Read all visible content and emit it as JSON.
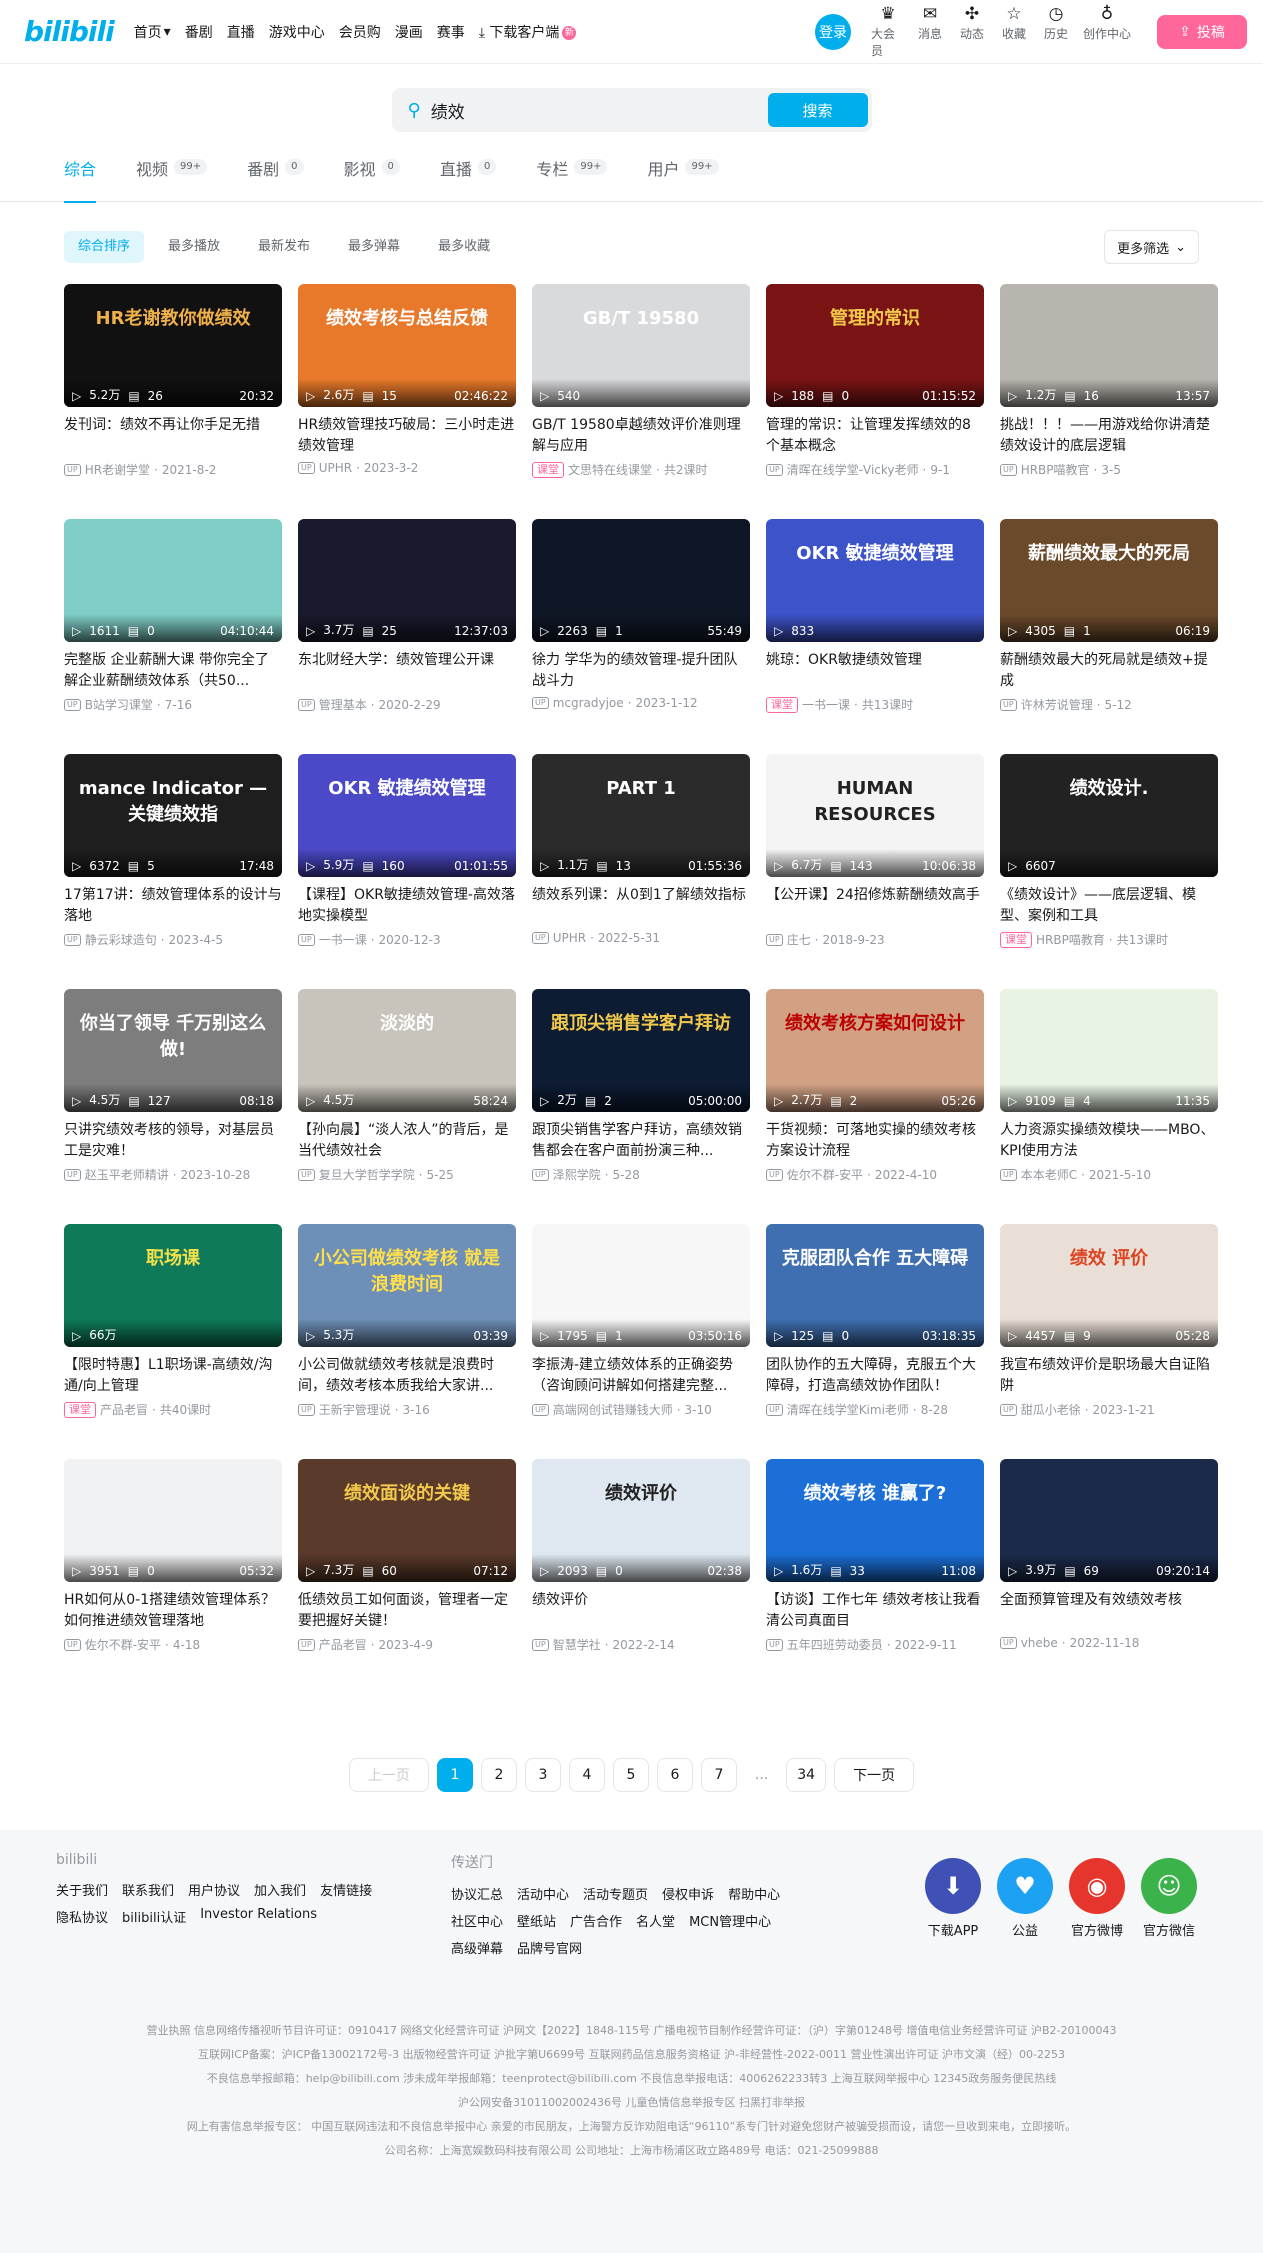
{
  "header": {
    "logo": "bilibili",
    "nav": [
      "首页",
      "番剧",
      "直播",
      "游戏中心",
      "会员购",
      "漫画",
      "赛事"
    ],
    "download": "下载客户端",
    "download_badge": "新",
    "login": "登录",
    "icons": [
      {
        "icon": "crown-icon",
        "glyph": "♛",
        "label": "大会员"
      },
      {
        "icon": "mail-icon",
        "glyph": "✉",
        "label": "消息"
      },
      {
        "icon": "pinwheel-icon",
        "glyph": "✣",
        "label": "动态"
      },
      {
        "icon": "star-icon",
        "glyph": "☆",
        "label": "收藏"
      },
      {
        "icon": "clock-icon",
        "glyph": "◷",
        "label": "历史"
      },
      {
        "icon": "bulb-icon",
        "glyph": "♁",
        "label": "创作中心"
      }
    ],
    "upload": "投稿"
  },
  "search": {
    "value": "绩效",
    "button": "搜索"
  },
  "tabs": [
    {
      "label": "综合",
      "count": ""
    },
    {
      "label": "视频",
      "count": "99+"
    },
    {
      "label": "番剧",
      "count": "0"
    },
    {
      "label": "影视",
      "count": "0"
    },
    {
      "label": "直播",
      "count": "0"
    },
    {
      "label": "专栏",
      "count": "99+"
    },
    {
      "label": "用户",
      "count": "99+"
    }
  ],
  "filters": [
    "综合排序",
    "最多播放",
    "最新发布",
    "最多弹幕",
    "最多收藏"
  ],
  "more_filter": "更多筛选",
  "videos": [
    {
      "title": "发刊词：绩效不再让你手足无措",
      "plays": "5.2万",
      "danmaku": "26",
      "duration": "20:32",
      "author": "HR老谢学堂",
      "date": "2021-8-2",
      "course": "",
      "thumb_text": "HR老谢教你做绩效",
      "bg": "#111",
      "fg": "#f0b04a"
    },
    {
      "title": "HR绩效管理技巧破局：三小时走进绩效管理",
      "plays": "2.6万",
      "danmaku": "15",
      "duration": "02:46:22",
      "author": "UPHR",
      "date": "2023-3-2",
      "course": "",
      "thumb_text": "绩效考核与总结反馈",
      "bg": "#e8792a",
      "fg": "#fff"
    },
    {
      "title": "GB/T 19580卓越绩效评价准则理解与应用",
      "plays": "540",
      "danmaku": "",
      "duration": "",
      "author": "文思特在线课堂",
      "date": "共2课时",
      "course": "课堂",
      "thumb_text": "GB/T 19580",
      "bg": "#d9dadc",
      "fg": "#fff"
    },
    {
      "title": "管理的常识：让管理发挥绩效的8个基本概念",
      "plays": "188",
      "danmaku": "0",
      "duration": "01:15:52",
      "author": "清晖在线学堂-Vicky老师",
      "date": "9-1",
      "course": "",
      "thumb_text": "管理的常识",
      "bg": "#7a1414",
      "fg": "#f2c94c"
    },
    {
      "title": "挑战！！！——用游戏给你讲清楚绩效设计的底层逻辑",
      "plays": "1.2万",
      "danmaku": "16",
      "duration": "13:57",
      "author": "HRBP喵教官",
      "date": "3-5",
      "course": "",
      "thumb_text": "",
      "bg": "#b8b4ae",
      "fg": "#fff"
    },
    {
      "title": "完整版 企业薪酬大课 带你完全了解企业薪酬绩效体系（共50...",
      "plays": "1611",
      "danmaku": "0",
      "duration": "04:10:44",
      "author": "B站学习课堂",
      "date": "7-16",
      "course": "",
      "thumb_text": "",
      "bg": "#7fcfc8",
      "fg": "#fff"
    },
    {
      "title": "东北财经大学：绩效管理公开课",
      "plays": "3.7万",
      "danmaku": "25",
      "duration": "12:37:03",
      "author": "管理基本",
      "date": "2020-2-29",
      "course": "",
      "thumb_text": "",
      "bg": "#1a1a2e",
      "fg": "#fff"
    },
    {
      "title": "徐力 学华为的绩效管理-提升团队战斗力",
      "plays": "2263",
      "danmaku": "1",
      "duration": "55:49",
      "author": "mcgradyjoe",
      "date": "2023-1-12",
      "course": "",
      "thumb_text": "",
      "bg": "#0f1726",
      "fg": "#fff"
    },
    {
      "title": "姚琼：OKR敏捷绩效管理",
      "plays": "833",
      "danmaku": "",
      "duration": "",
      "author": "一书一课",
      "date": "共13课时",
      "course": "课堂",
      "thumb_text": "OKR 敏捷绩效管理",
      "bg": "#3d53c9",
      "fg": "#fff"
    },
    {
      "title": "薪酬绩效最大的死局就是绩效+提成",
      "plays": "4305",
      "danmaku": "1",
      "duration": "06:19",
      "author": "许林芳说管理",
      "date": "5-12",
      "course": "",
      "thumb_text": "薪酬绩效最大的死局",
      "bg": "#6b4a2b",
      "fg": "#fff"
    },
    {
      "title": "17第17讲：绩效管理体系的设计与落地",
      "plays": "6372",
      "danmaku": "5",
      "duration": "17:48",
      "author": "静云彩球造句",
      "date": "2023-4-5",
      "course": "",
      "thumb_text": "mance Indicator — 关键绩效指",
      "bg": "#1e1e1e",
      "fg": "#fff"
    },
    {
      "title": "【课程】OKR敏捷绩效管理-高效落地实操模型",
      "plays": "5.9万",
      "danmaku": "160",
      "duration": "01:01:55",
      "author": "一书一课",
      "date": "2020-12-3",
      "course": "",
      "thumb_text": "OKR 敏捷绩效管理",
      "bg": "#4b49c8",
      "fg": "#fff"
    },
    {
      "title": "绩效系列课：从0到1了解绩效指标",
      "plays": "1.1万",
      "danmaku": "13",
      "duration": "01:55:36",
      "author": "UPHR",
      "date": "2022-5-31",
      "course": "",
      "thumb_text": "PART 1",
      "bg": "#2b2b2b",
      "fg": "#fff"
    },
    {
      "title": "【公开课】24招修炼薪酬绩效高手",
      "plays": "6.7万",
      "danmaku": "143",
      "duration": "10:06:38",
      "author": "庄七",
      "date": "2018-9-23",
      "course": "",
      "thumb_text": "HUMAN RESOURCES",
      "bg": "#f4f4f4",
      "fg": "#222"
    },
    {
      "title": "《绩效设计》——底层逻辑、模型、案例和工具",
      "plays": "6607",
      "danmaku": "",
      "duration": "",
      "author": "HRBP喵教育",
      "date": "共13课时",
      "course": "课堂",
      "thumb_text": "绩效设计.",
      "bg": "#222",
      "fg": "#fff"
    },
    {
      "title": "只讲究绩效考核的领导，对基层员工是灾难！",
      "plays": "4.5万",
      "danmaku": "127",
      "duration": "08:18",
      "author": "赵玉平老师精讲",
      "date": "2023-10-28",
      "course": "",
      "thumb_text": "你当了领导 千万别这么做!",
      "bg": "#7d7d7d",
      "fg": "#fff"
    },
    {
      "title": "【孙向晨】“淡人浓人”的背后，是当代绩效社会",
      "plays": "4.5万",
      "danmaku": "",
      "duration": "58:24",
      "author": "复旦大学哲学学院",
      "date": "5-25",
      "course": "",
      "thumb_text": "淡淡的",
      "bg": "#c9c4bb",
      "fg": "#fff"
    },
    {
      "title": "跟顶尖销售学客户拜访，高绩效销售都会在客户面前扮演三种...",
      "plays": "2万",
      "danmaku": "2",
      "duration": "05:00:00",
      "author": "泽熙学院",
      "date": "5-28",
      "course": "",
      "thumb_text": "跟顶尖销售学客户拜访",
      "bg": "#0d1b33",
      "fg": "#f2c94c"
    },
    {
      "title": "干货视频：可落地实操的绩效考核方案设计流程",
      "plays": "2.7万",
      "danmaku": "2",
      "duration": "05:26",
      "author": "佐尔不群-安平",
      "date": "2022-4-10",
      "course": "",
      "thumb_text": "绩效考核方案如何设计",
      "bg": "#d2a184",
      "fg": "#b00"
    },
    {
      "title": "人力资源实操绩效模块——MBO、KPI使用方法",
      "plays": "9109",
      "danmaku": "4",
      "duration": "11:35",
      "author": "本本老师C",
      "date": "2021-5-10",
      "course": "",
      "thumb_text": "",
      "bg": "#e8f3e4",
      "fg": "#222"
    },
    {
      "title": "【限时特惠】L1职场课-高绩效/沟通/向上管理",
      "plays": "66万",
      "danmaku": "",
      "duration": "",
      "author": "产品老冒",
      "date": "共40课时",
      "course": "课堂",
      "thumb_text": "职场课",
      "bg": "#0e7a5a",
      "fg": "#f2e14c"
    },
    {
      "title": "小公司做就绩效考核就是浪费时间，绩效考核本质我给大家讲...",
      "plays": "5.3万",
      "danmaku": "",
      "duration": "03:39",
      "author": "王新宇管理说",
      "date": "3-16",
      "course": "",
      "thumb_text": "小公司做绩效考核 就是浪费时间",
      "bg": "#6e8fb8",
      "fg": "#ffe04a"
    },
    {
      "title": "李振涛-建立绩效体系的正确姿势（咨询顾问讲解如何搭建完整...",
      "plays": "1795",
      "danmaku": "1",
      "duration": "03:50:16",
      "author": "高端网创试错赚钱大师",
      "date": "3-10",
      "course": "",
      "thumb_text": "",
      "bg": "#f7f7f7",
      "fg": "#222"
    },
    {
      "title": "团队协作的五大障碍，克服五个大障碍，打造高绩效协作团队！",
      "plays": "125",
      "danmaku": "0",
      "duration": "03:18:35",
      "author": "清晖在线学堂Kimi老师",
      "date": "8-28",
      "course": "",
      "thumb_text": "克服团队合作 五大障碍",
      "bg": "#3f6fb0",
      "fg": "#fff"
    },
    {
      "title": "我宣布绩效评价是职场最大自证陷阱",
      "plays": "4457",
      "danmaku": "9",
      "duration": "05:28",
      "author": "甜瓜小老徐",
      "date": "2023-1-21",
      "course": "",
      "thumb_text": "绩效 评价",
      "bg": "#e9dfd6",
      "fg": "#d42"
    },
    {
      "title": "HR如何从0-1搭建绩效管理体系？如何推进绩效管理落地",
      "plays": "3951",
      "danmaku": "0",
      "duration": "05:32",
      "author": "佐尔不群-安平",
      "date": "4-18",
      "course": "",
      "thumb_text": "",
      "bg": "#f1f2f3",
      "fg": "#222"
    },
    {
      "title": "低绩效员工如何面谈，管理者一定要把握好关键！",
      "plays": "7.3万",
      "danmaku": "60",
      "duration": "07:12",
      "author": "产品老冒",
      "date": "2023-4-9",
      "course": "",
      "thumb_text": "绩效面谈的关键",
      "bg": "#5a3a2a",
      "fg": "#f2c94c"
    },
    {
      "title": "绩效评价",
      "plays": "2093",
      "danmaku": "0",
      "duration": "02:38",
      "author": "智慧学社",
      "date": "2022-2-14",
      "course": "",
      "thumb_text": "绩效评价",
      "bg": "#dfe8f0",
      "fg": "#222"
    },
    {
      "title": "【访谈】工作七年 绩效考核让我看清公司真面目",
      "plays": "1.6万",
      "danmaku": "33",
      "duration": "11:08",
      "author": "五年四班劳动委员",
      "date": "2022-9-11",
      "course": "",
      "thumb_text": "绩效考核 谁赢了?",
      "bg": "#1b6fd6",
      "fg": "#fff"
    },
    {
      "title": "全面预算管理及有效绩效考核",
      "plays": "3.9万",
      "danmaku": "69",
      "duration": "09:20:14",
      "author": "vhebe",
      "date": "2022-11-18",
      "course": "",
      "thumb_text": "",
      "bg": "#1b2a4a",
      "fg": "#fff"
    }
  ],
  "pagination": {
    "prev": "上一页",
    "pages": [
      "1",
      "2",
      "3",
      "4",
      "5",
      "6",
      "7"
    ],
    "dots": "...",
    "last": "34",
    "next": "下一页"
  },
  "footer": {
    "col1_title": "bilibili",
    "col1_links": [
      "关于我们",
      "联系我们",
      "用户协议",
      "加入我们",
      "友情链接",
      "隐私协议",
      "bilibili认证",
      "Investor Relations"
    ],
    "col2_title": "传送门",
    "col2_links": [
      "协议汇总",
      "活动中心",
      "活动专题页",
      "侵权申诉",
      "帮助中心",
      "社区中心",
      "壁纸站",
      "广告合作",
      "名人堂",
      "MCN管理中心",
      "高级弹幕",
      "品牌号官网"
    ],
    "apps": [
      {
        "label": "下载APP",
        "color": "#3f51b5",
        "glyph": "⬇"
      },
      {
        "label": "公益",
        "color": "#1da1f2",
        "glyph": "♥"
      },
      {
        "label": "官方微博",
        "color": "#e6352c",
        "glyph": "◉"
      },
      {
        "label": "官方微信",
        "color": "#3cb34a",
        "glyph": "☺"
      }
    ],
    "legal": [
      "营业执照 信息网络传播视听节目许可证：0910417 网络文化经营许可证 沪网文【2022】1848-115号 广播电视节目制作经营许可证：（沪）字第01248号 增值电信业务经营许可证 沪B2-20100043",
      "互联网ICP备案：沪ICP备13002172号-3 出版物经营许可证 沪批字第U6699号 互联网药品信息服务资格证 沪-非经营性-2022-0011 营业性演出许可证 沪市文演（经）00-2253",
      "不良信息举报邮箱：help@bilibili.com 涉未成年举报邮箱：teenprotect@bilibili.com 不良信息举报电话：4006262233转3 上海互联网举报中心 12345政务服务便民热线",
      "沪公网安备31011002002436号 儿童色情信息举报专区 扫黑打非举报",
      "网上有害信息举报专区： 中国互联网违法和不良信息举报中心 亲爱的市民朋友，上海警方反诈劝阻电话“96110”系专门针对避免您财产被骗受损而设，请您一旦收到来电，立即接听。",
      "公司名称：上海宽娱数码科技有限公司 公司地址：上海市杨浦区政立路489号 电话：021-25099888"
    ]
  },
  "colors": {
    "accent": "#00aeec",
    "pink": "#ff6699"
  }
}
